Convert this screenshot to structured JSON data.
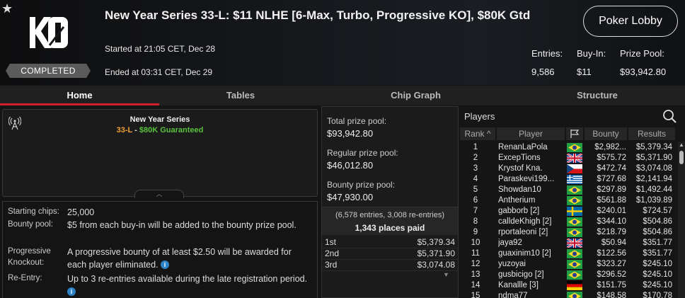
{
  "header": {
    "star_icon": "star-icon",
    "logo_text": "KO",
    "status": "COMPLETED",
    "title": "New Year Series 33-L: $11 NLHE [6-Max, Turbo, Progressive KO], $80K Gtd",
    "started": "Started at 21:05 CET, Dec 28",
    "ended": "Ended at 03:31 CET, Dec 29",
    "lobby_button": "Poker Lobby",
    "stats": {
      "entries_label": "Entries:",
      "entries": "9,586",
      "buyin_label": "Buy-In:",
      "buyin": "$11",
      "prize_label": "Prize Pool:",
      "prize": "$93,942.80"
    }
  },
  "tabs": [
    {
      "label": "Home",
      "active": true
    },
    {
      "label": "Tables",
      "active": false
    },
    {
      "label": "Chip Graph",
      "active": false
    },
    {
      "label": "Structure",
      "active": false
    }
  ],
  "series": {
    "name": "New Year Series",
    "code": "33-L",
    "separator": " - ",
    "guarantee": "$80K Guaranteed",
    "colors": {
      "code": "#f0a030",
      "guarantee": "#58c03c"
    }
  },
  "info": [
    {
      "label": "Starting chips:",
      "value": "25,000",
      "has_info": false
    },
    {
      "label": "Bounty pool:",
      "value": "$5 from each buy-in will be added to the bounty prize pool.",
      "has_info": false
    },
    {
      "label": "Progressive Knockout:",
      "value": "A progressive bounty of at least $2.50 will be awarded for each player eliminated.",
      "has_info": true
    },
    {
      "label": "Re-Entry:",
      "value": "Up to 3 re-entries available during the late registration period.",
      "has_info": true
    }
  ],
  "prizes": {
    "total_label": "Total prize pool:",
    "total": "$93,942.80",
    "regular_label": "Regular prize pool:",
    "regular": "$46,012.80",
    "bounty_label": "Bounty prize pool:",
    "bounty": "$47,930.00",
    "entries_note": "(6,578 entries, 3,008 re-entries)",
    "places_paid": "1,343 places paid",
    "payouts": [
      {
        "place": "1st",
        "amount": "$5,379.34"
      },
      {
        "place": "2nd",
        "amount": "$5,371.90"
      },
      {
        "place": "3rd",
        "amount": "$3,074.08"
      }
    ]
  },
  "players": {
    "title": "Players",
    "columns": {
      "rank": "Rank",
      "player": "Player",
      "bounty": "Bounty",
      "results": "Results"
    },
    "rows": [
      {
        "rank": "1",
        "name": "RenanLaPola",
        "flag": "brazil",
        "bounty": "$2,982...",
        "result": "$5,379.34"
      },
      {
        "rank": "2",
        "name": "ExcepTions",
        "flag": "uk",
        "bounty": "$575.72",
        "result": "$5,371.90"
      },
      {
        "rank": "3",
        "name": "Krystof Kna.",
        "flag": "czech",
        "bounty": "$472.74",
        "result": "$3,074.08"
      },
      {
        "rank": "4",
        "name": "Paraskevi199...",
        "flag": "greece",
        "bounty": "$727.68",
        "result": "$2,141.94"
      },
      {
        "rank": "5",
        "name": "Showdan10",
        "flag": "brazil",
        "bounty": "$297.89",
        "result": "$1,492.44"
      },
      {
        "rank": "6",
        "name": "Antherium",
        "flag": "brazil",
        "bounty": "$561.88",
        "result": "$1,039.89"
      },
      {
        "rank": "7",
        "name": "gabborb [2]",
        "flag": "sweden",
        "bounty": "$240.01",
        "result": "$724.57"
      },
      {
        "rank": "8",
        "name": "calldeKhigh [2]",
        "flag": "brazil",
        "bounty": "$344.10",
        "result": "$504.86"
      },
      {
        "rank": "9",
        "name": "rportaleoni [2]",
        "flag": "brazil",
        "bounty": "$218.79",
        "result": "$504.86"
      },
      {
        "rank": "10",
        "name": "jaya92",
        "flag": "uk",
        "bounty": "$50.94",
        "result": "$351.77"
      },
      {
        "rank": "11",
        "name": "guaxinim10 [2]",
        "flag": "brazil",
        "bounty": "$122.56",
        "result": "$351.77"
      },
      {
        "rank": "12",
        "name": "yuzoyai",
        "flag": "brazil",
        "bounty": "$323.27",
        "result": "$245.10"
      },
      {
        "rank": "13",
        "name": "gusbicigo [2]",
        "flag": "brazil",
        "bounty": "$296.52",
        "result": "$245.10"
      },
      {
        "rank": "14",
        "name": "Kanallle [3]",
        "flag": "germany",
        "bounty": "$151.75",
        "result": "$245.10"
      },
      {
        "rank": "15",
        "name": "ndma77",
        "flag": "brazil",
        "bounty": "$148.58",
        "result": "$170.78"
      }
    ]
  }
}
